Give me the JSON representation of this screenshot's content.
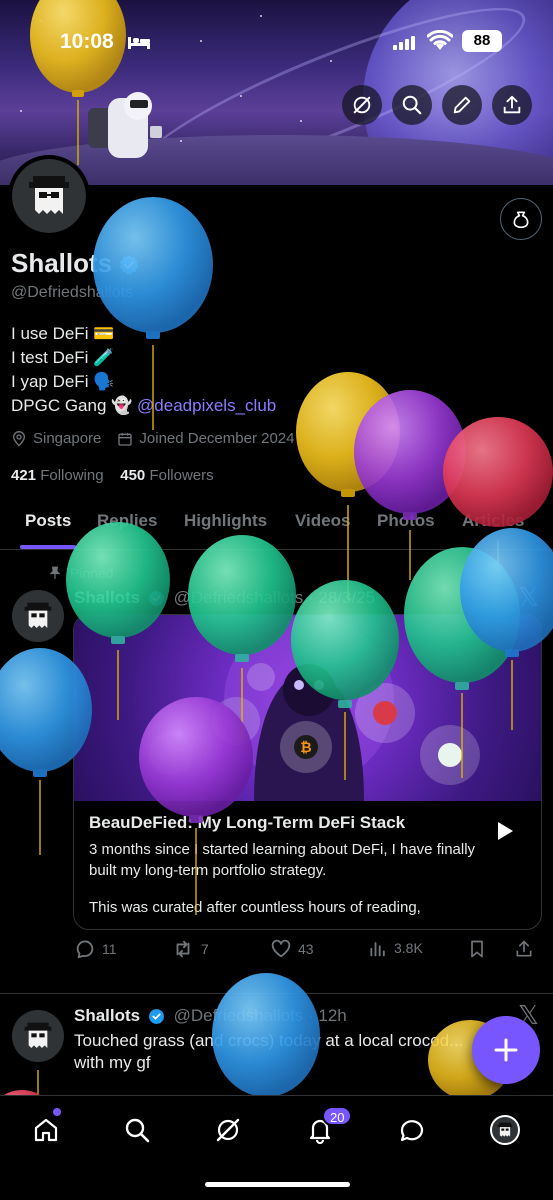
{
  "status_bar": {
    "time": "10:08",
    "battery": "88"
  },
  "profile": {
    "name": "Shallots",
    "handle": "@Defriedshallots",
    "bio": [
      "I use DeFi 💳",
      "I test DeFi 🧪",
      "I yap DeFi 🗣️",
      "DPGC Gang 👻 "
    ],
    "bio_mention": "@deadpixels_club",
    "location": "Singapore",
    "joined": "Joined December 2024",
    "following_count": "421",
    "following_label": "Following",
    "followers_count": "450",
    "followers_label": "Followers"
  },
  "tabs": [
    "Posts",
    "Replies",
    "Highlights",
    "Videos",
    "Photos",
    "Articles"
  ],
  "active_tab": "Posts",
  "pinned_post": {
    "pinned_label": "Pinned",
    "name": "Shallots",
    "handle_time": "@Defriedshallots · 28/3/25",
    "card_title": "BeauDeFied: My Long-Term DeFi Stack",
    "card_text_1": "3 months since I started learning about DeFi, I have finally built my long-term portfolio strategy.",
    "card_text_2": "This was curated after countless hours of reading,",
    "replies": "11",
    "reposts": "7",
    "likes": "43",
    "views": "3.8K"
  },
  "second_post": {
    "name": "Shallots",
    "handle_time": "@Defriedshallots · 12h",
    "text": "Touched grass (and crocs) today at a local crocod... with my gf"
  },
  "bottom_nav": {
    "notification_count": "20"
  },
  "colors": {
    "accent": "#7856ff",
    "mention": "#8b7cff",
    "verified": "#1d9bf0",
    "muted": "#71767b",
    "background": "#000000"
  },
  "icons": [
    "search-icon",
    "edit-icon",
    "share-icon",
    "grok-icon",
    "tip-jar-icon",
    "location-icon",
    "calendar-icon",
    "pin-icon",
    "reply-icon",
    "repost-icon",
    "like-icon",
    "views-icon",
    "bookmark-icon",
    "play-icon",
    "home-icon",
    "notifications-icon",
    "messages-icon",
    "compose-icon"
  ]
}
